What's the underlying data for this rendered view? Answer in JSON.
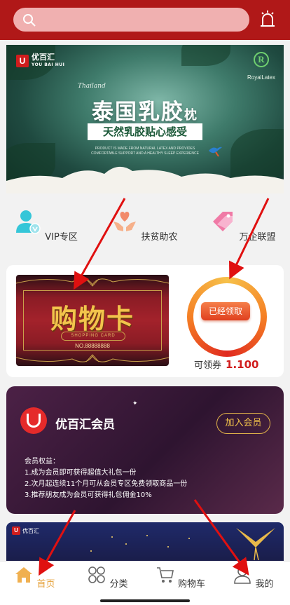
{
  "header": {
    "search_placeholder": ""
  },
  "banner": {
    "brand": "优百汇",
    "brand_sub": "YOU BAI HUI",
    "partner": "RoyalLatex",
    "script_text": "Thailand",
    "title_main": "泰国乳胶",
    "title_suffix": "枕",
    "tagline": "天然乳胶贴心感受",
    "fine_print": "PRODUCT IS MADE FROM NATURAL LATEX AND PROVIDES COMFORTABLE SUPPORT AND A HEALTHY SLEEP EXPERIENCE"
  },
  "categories": [
    {
      "label": "VIP专区",
      "icon": "vip-user-icon",
      "color": "#35c6d8"
    },
    {
      "label": "扶贫助农",
      "icon": "heart-hands-icon",
      "color": "#f28a6a"
    },
    {
      "label": "万企联盟",
      "icon": "tag-icon",
      "color": "#f07aa6"
    }
  ],
  "shopping_card": {
    "title": "购物卡",
    "subtitle": "SHOPPING CARD",
    "number": "NO.88888888",
    "claim_button": "已经领取",
    "voucher_label": "可领券",
    "voucher_value": "1.100"
  },
  "member": {
    "name": "优百汇会员",
    "join_button": "加入会员",
    "benefits_title": "会员权益：",
    "benefits": [
      "1.成为会员即可获得超值大礼包一份",
      "2.次月起连续11个月可从会员专区免费领取商品一份",
      "3.推荐朋友成为会员可获得礼包佣金10%"
    ]
  },
  "promo": {
    "brand": "优百汇"
  },
  "tabbar": [
    {
      "label": "首页",
      "icon": "home-icon",
      "active": true
    },
    {
      "label": "分类",
      "icon": "grid-icon",
      "active": false
    },
    {
      "label": "购物车",
      "icon": "cart-icon",
      "active": false
    },
    {
      "label": "我的",
      "icon": "user-icon",
      "active": false
    }
  ],
  "colors": {
    "header": "#b01818",
    "accent": "#e5a13a",
    "price": "#d11d1d",
    "arrow": "#e01010"
  }
}
